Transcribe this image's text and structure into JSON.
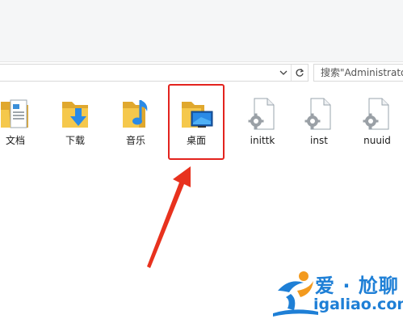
{
  "address": {
    "search_placeholder": "搜索\"Administrato"
  },
  "files": [
    {
      "label": "文档",
      "icon": "documents-folder-icon"
    },
    {
      "label": "下载",
      "icon": "downloads-folder-icon"
    },
    {
      "label": "音乐",
      "icon": "music-folder-icon"
    },
    {
      "label": "桌面",
      "icon": "desktop-folder-icon"
    },
    {
      "label": "inittk",
      "icon": "system-file-icon"
    },
    {
      "label": "inst",
      "icon": "system-file-icon"
    },
    {
      "label": "nuuid",
      "icon": "system-file-icon"
    }
  ],
  "annotation": {
    "highlight_color": "#e3231e",
    "arrow_color": "#e8321e"
  },
  "watermark": {
    "cn_text": "爱 · 尬聊",
    "en_text": "igaliao.com"
  },
  "colors": {
    "folder": "#f5c84c",
    "folder_dark": "#e0a82e",
    "accent_blue": "#2a8ae6",
    "watermark_blue": "#1e7fd6",
    "watermark_orange": "#f39a1e"
  }
}
